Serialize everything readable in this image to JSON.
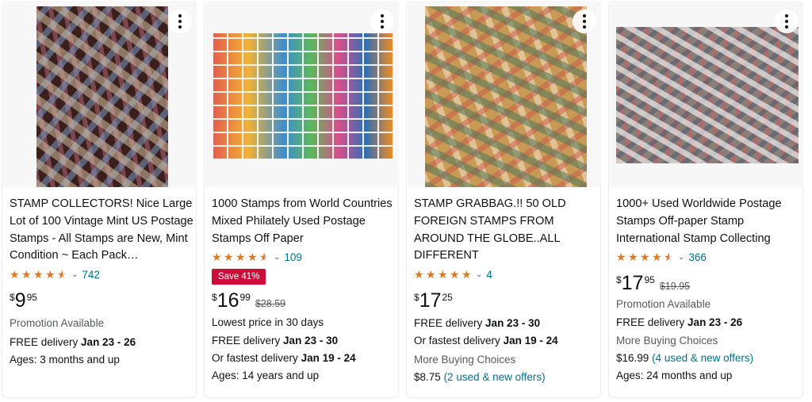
{
  "colors": {
    "star": "#de7921",
    "link": "#007185",
    "badge": "#cc0c39"
  },
  "products": [
    {
      "title": "STAMP COLLECTORS! Nice Large Lot of 100 Vintage Mint US Postage Stamps - All Stamps are New, Mint Condition ~ Each Pack…",
      "rating": 4.5,
      "review_count": "742",
      "price_currency": "$",
      "price_whole": "9",
      "price_fraction": "95",
      "promotion": "Promotion Available",
      "delivery_prefix": "FREE delivery",
      "delivery_dates": "Jan 23 - 26",
      "ages": "Ages: 3 months and up"
    },
    {
      "title": "1000 Stamps from World Countries Mixed Philately Used Postage Stamps Off Paper",
      "rating": 4.5,
      "review_count": "109",
      "badge": "Save 41%",
      "price_currency": "$",
      "price_whole": "16",
      "price_fraction": "99",
      "list_price": "$28.59",
      "lowest_price_note": "Lowest price in 30 days",
      "delivery_prefix": "FREE delivery",
      "delivery_dates": "Jan 23 - 30",
      "fastest_prefix": "Or fastest delivery",
      "fastest_dates": "Jan 19 - 24",
      "ages": "Ages: 14 years and up"
    },
    {
      "title": "STAMP GRABBAG.!! 50 OLD FOREIGN STAMPS FROM AROUND THE GLOBE..ALL DIFFERENT",
      "rating": 5,
      "review_count": "4",
      "price_currency": "$",
      "price_whole": "17",
      "price_fraction": "25",
      "delivery_prefix": "FREE delivery",
      "delivery_dates": "Jan 23 - 30",
      "fastest_prefix": "Or fastest delivery",
      "fastest_dates": "Jan 19 - 24",
      "more_buying": "More Buying Choices",
      "offer_price": "$8.75",
      "offers_link": "(2 used & new offers)"
    },
    {
      "title": "1000+ Used Worldwide Postage Stamps Off-paper Stamp International Stamp Collecting",
      "rating": 4.5,
      "review_count": "366",
      "price_currency": "$",
      "price_whole": "17",
      "price_fraction": "95",
      "list_price": "$19.95",
      "promotion": "Promotion Available",
      "delivery_prefix": "FREE delivery",
      "delivery_dates": "Jan 23 - 26",
      "more_buying": "More Buying Choices",
      "offer_price": "$16.99",
      "offers_link": "(4 used & new offers)",
      "ages": "Ages: 24 months and up"
    }
  ]
}
